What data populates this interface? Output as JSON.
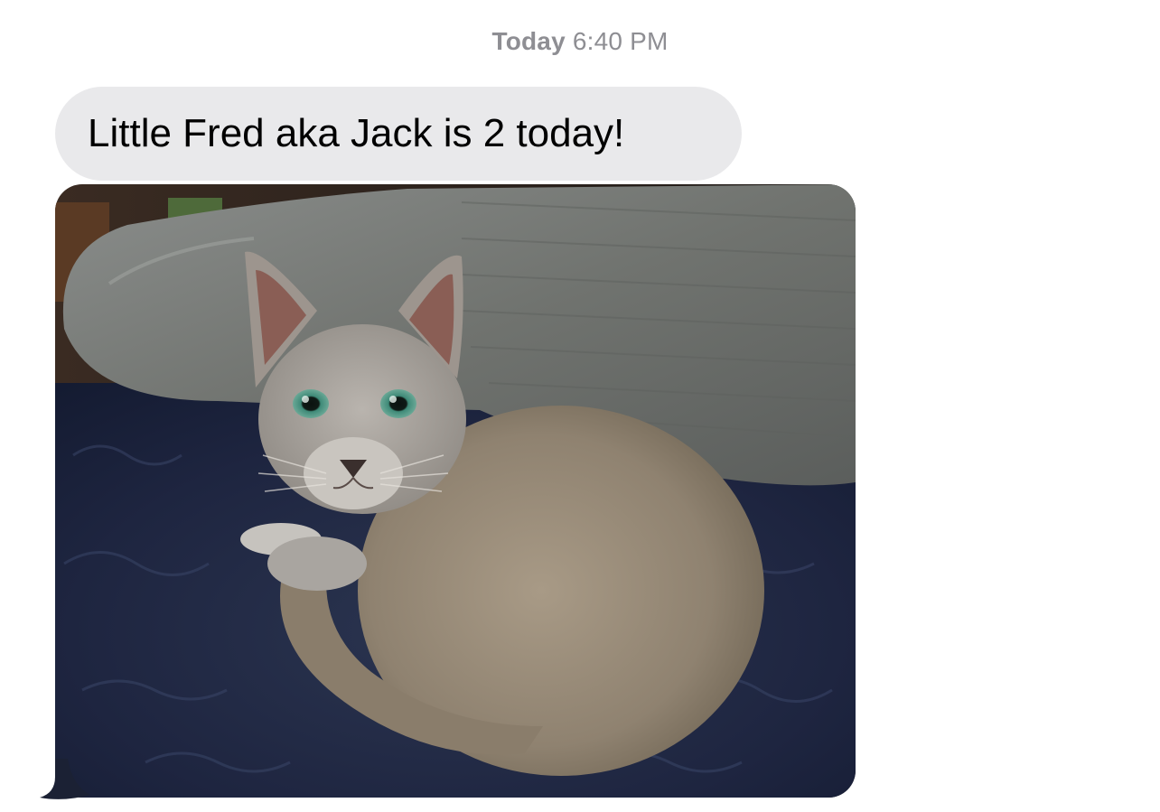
{
  "header": {
    "timestamp_day": "Today",
    "timestamp_time": "6:40 PM"
  },
  "messages": [
    {
      "type": "text",
      "direction": "incoming",
      "text": "Little Fred aka Jack is 2 today!"
    },
    {
      "type": "photo",
      "direction": "incoming",
      "icon": "photo-attachment"
    }
  ],
  "colors": {
    "incoming_bubble": "#e9e9eb",
    "timestamp_text": "#8e8e93",
    "background": "#ffffff"
  }
}
